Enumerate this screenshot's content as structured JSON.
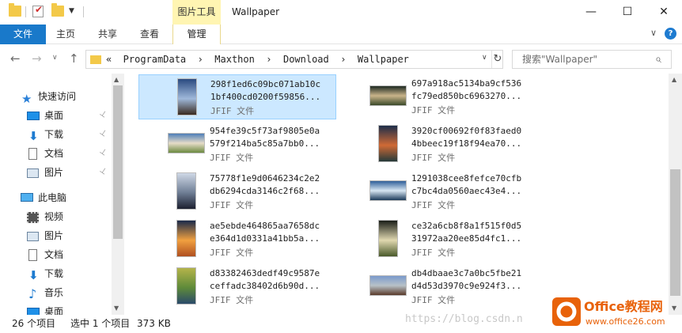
{
  "titlebar": {
    "context_tab_group": "图片工具",
    "window_title": "Wallpaper",
    "minimize": "—",
    "maximize": "☐",
    "close": "✕"
  },
  "ribbon": {
    "file": "文件",
    "home": "主页",
    "share": "共享",
    "view": "查看",
    "manage": "管理",
    "collapse": "∨",
    "help": "?"
  },
  "nav": {
    "back": "←",
    "forward": "→",
    "recent": "∨",
    "up": "↑",
    "address_text": "«  ProgramData  ›  Maxthon  ›  Download  ›  Wallpaper",
    "refresh": "↻",
    "search_placeholder": "搜索\"Wallpaper\""
  },
  "sidebar": {
    "items": [
      {
        "label": "快速访问",
        "icon": "star-icon"
      },
      {
        "label": "桌面",
        "icon": "desktop-icon"
      },
      {
        "label": "下载",
        "icon": "download-icon"
      },
      {
        "label": "文档",
        "icon": "document-icon"
      },
      {
        "label": "图片",
        "icon": "picture-icon"
      },
      {
        "label": "此电脑",
        "icon": "computer-icon"
      },
      {
        "label": "视频",
        "icon": "video-icon"
      },
      {
        "label": "图片",
        "icon": "picture-icon"
      },
      {
        "label": "文档",
        "icon": "document-icon"
      },
      {
        "label": "下载",
        "icon": "download-icon"
      },
      {
        "label": "音乐",
        "icon": "music-icon"
      },
      {
        "label": "桌面",
        "icon": "desktop-icon"
      }
    ],
    "pin_glyph": "📌"
  },
  "files": [
    {
      "line1": "298f1ed6c09bc071ab10c",
      "line2": "1bf400cd0200f59856...",
      "type": "JFIF 文件",
      "orientation": "portrait",
      "palette": [
        "#2a4a80",
        "#9fb8da",
        "#3a2a20"
      ],
      "selected": true
    },
    {
      "line1": "697a918ac5134ba9cf536",
      "line2": "fc79ed850bc6963270...",
      "type": "JFIF 文件",
      "orientation": "landscape",
      "palette": [
        "#1e2a22",
        "#c9b48a",
        "#3b4a2a"
      ],
      "selected": false
    },
    {
      "line1": "954fe39c5f73af9805e0a",
      "line2": "579f214ba5c85a7bb0...",
      "type": "JFIF 文件",
      "orientation": "landscape",
      "palette": [
        "#4f7fb8",
        "#e6dcc8",
        "#6c8a40"
      ],
      "selected": false
    },
    {
      "line1": "3920cf00692f0f83faed0",
      "line2": "4bbeec19f18f94ea70...",
      "type": "JFIF 文件",
      "orientation": "portrait",
      "palette": [
        "#1d2e4a",
        "#d06a35",
        "#263a3a"
      ],
      "selected": false
    },
    {
      "line1": "75778f1e9d0646234c2e2",
      "line2": "db6294cda3146c2f68...",
      "type": "JFIF 文件",
      "orientation": "portrait",
      "palette": [
        "#cfd8e6",
        "#6e7d94",
        "#1c2030"
      ],
      "selected": false
    },
    {
      "line1": "1291038cee8fefce70cfb",
      "line2": "c7bc4da0560aec43e4...",
      "type": "JFIF 文件",
      "orientation": "landscape",
      "palette": [
        "#2f5f99",
        "#d7e6f2",
        "#1c3a5a"
      ],
      "selected": false
    },
    {
      "line1": "ae5ebde464865aa7658dc",
      "line2": "e364d1d0331a41bb5a...",
      "type": "JFIF 文件",
      "orientation": "portrait",
      "palette": [
        "#1a2a4a",
        "#f0a040",
        "#b05020"
      ],
      "selected": false
    },
    {
      "line1": "ce32a6cb8f8a1f515f0d5",
      "line2": "31972aa20ee85d4fc1...",
      "type": "JFIF 文件",
      "orientation": "portrait",
      "palette": [
        "#1a1e18",
        "#e0d8b0",
        "#4a5a2a"
      ],
      "selected": false
    },
    {
      "line1": "d83382463dedf49c9587e",
      "line2": "ceffadc38402d6b90d...",
      "type": "JFIF 文件",
      "orientation": "portrait",
      "palette": [
        "#b4b44a",
        "#5e8a3a",
        "#2a4a6a"
      ],
      "selected": false
    },
    {
      "line1": "db4dbaae3c7a0bc5fbe21",
      "line2": "d4d53d3970c9e924f3...",
      "type": "JFIF 文件",
      "orientation": "landscape",
      "palette": [
        "#7a9acc",
        "#b8c2c8",
        "#5a3a2a"
      ],
      "selected": false
    }
  ],
  "status": {
    "item_count": "26 个项目",
    "selection": "选中 1 个项目",
    "size": "373 KB"
  },
  "watermark": {
    "url": "https://blog.csdn.n",
    "logo_line1": "Office教程网",
    "logo_line2": "www.office26.com"
  },
  "colors": {
    "accent": "#1979ca",
    "selection_bg": "#cce8ff",
    "selection_border": "#99d1ff",
    "context_tab": "#fff5b2",
    "folder": "#f3c949",
    "logo_orange": "#e8620a"
  }
}
